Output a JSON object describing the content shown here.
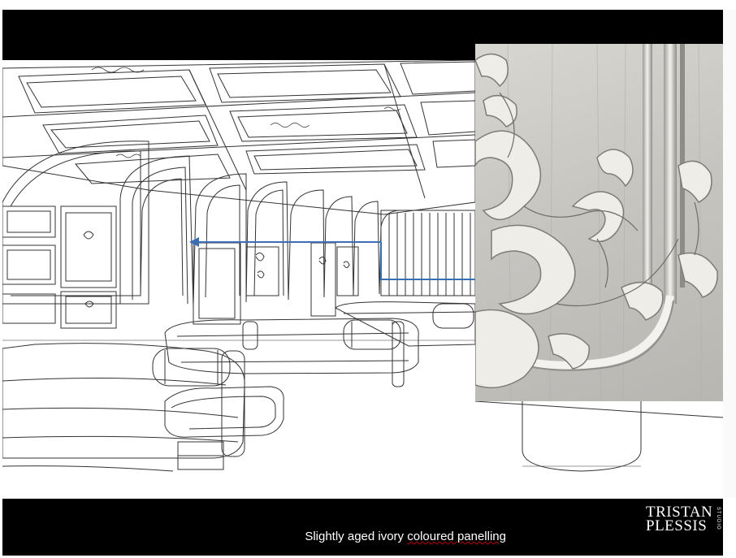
{
  "slide": {
    "caption_part1": "Slightly  aged ivory ",
    "caption_part2": "coloured panelling",
    "logo_line1": "TRISTAN",
    "logo_line2": "PLESSIS",
    "logo_sub": "STUDIO"
  },
  "colors": {
    "bar": "#000000",
    "arrow": "#3a6fb5",
    "line": "#333333"
  }
}
